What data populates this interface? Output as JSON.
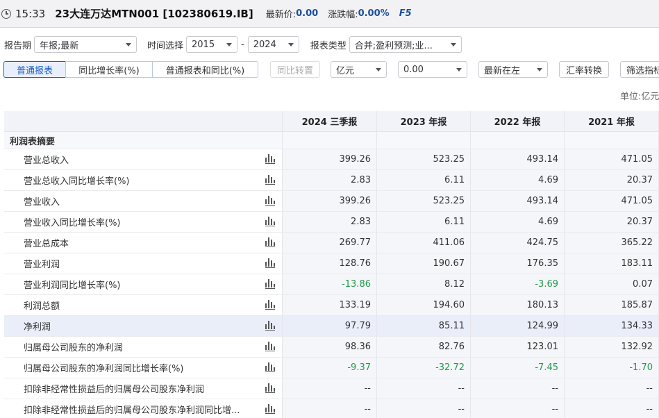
{
  "header": {
    "time": "15:33",
    "title": "23大连万达MTN001 [102380619.IB]",
    "latest_price_label": "最新价:",
    "latest_price": "0.00",
    "change_label": "涨跌幅:",
    "change": "0.00%",
    "shortcut": "F5"
  },
  "filters": {
    "report_period_label": "报告期",
    "report_period": "年报;最新",
    "time_label": "时间选择",
    "year_from": "2015",
    "dash": "-",
    "year_to": "2024",
    "report_type_label": "报表类型",
    "report_type": "合并;盈利预测;业..."
  },
  "toolbar": {
    "tab_normal": "普通报表",
    "tab_yoy": "同比增长率(%)",
    "tab_normal_yoy": "普通报表和同比(%)",
    "btn_transpose": "同比转置",
    "unit_select": "亿元",
    "decimal_select": "0.00",
    "order_select": "最新在左",
    "btn_fx": "汇率转换",
    "btn_filter": "筛选指标"
  },
  "unit_label": "单位:亿元",
  "table": {
    "columns": [
      "2024 三季报",
      "2023 年报",
      "2022 年报",
      "2021 年报"
    ],
    "section": "利润表摘要",
    "rows": [
      {
        "name": "营业总收入",
        "v": [
          "399.26",
          "523.25",
          "493.14",
          "471.05"
        ]
      },
      {
        "name": "营业总收入同比增长率(%)",
        "v": [
          "2.83",
          "6.11",
          "4.69",
          "20.37"
        ]
      },
      {
        "name": "营业收入",
        "v": [
          "399.26",
          "523.25",
          "493.14",
          "471.05"
        ]
      },
      {
        "name": "营业收入同比增长率(%)",
        "v": [
          "2.83",
          "6.11",
          "4.69",
          "20.37"
        ]
      },
      {
        "name": "营业总成本",
        "v": [
          "269.77",
          "411.06",
          "424.75",
          "365.22"
        ]
      },
      {
        "name": "营业利润",
        "v": [
          "128.76",
          "190.67",
          "176.35",
          "183.11"
        ]
      },
      {
        "name": "营业利润同比增长率(%)",
        "v": [
          "-13.86",
          "8.12",
          "-3.69",
          "0.07"
        ]
      },
      {
        "name": "利润总额",
        "v": [
          "133.19",
          "194.60",
          "180.13",
          "185.87"
        ]
      },
      {
        "name": "净利润",
        "v": [
          "97.79",
          "85.11",
          "124.99",
          "134.33"
        ]
      },
      {
        "name": "归属母公司股东的净利润",
        "v": [
          "98.36",
          "82.76",
          "123.01",
          "132.92"
        ]
      },
      {
        "name": "归属母公司股东的净利润同比增长率(%)",
        "v": [
          "-9.37",
          "-32.72",
          "-7.45",
          "-1.70"
        ]
      },
      {
        "name": "扣除非经常性损益后的归属母公司股东净利润",
        "v": [
          "--",
          "--",
          "--",
          "--"
        ]
      },
      {
        "name": "扣除非经常性损益后的归属母公司股东净利润同比增...",
        "v": [
          "--",
          "--",
          "--",
          "--"
        ]
      }
    ]
  },
  "colors": {
    "accent": "#1a5bc7",
    "negative": "#1f9a48",
    "highlight_row": "#e9eef9"
  },
  "icons": {
    "clock": "clock-icon",
    "chart": "bar-chart-icon",
    "dropdown": "chevron-down-icon"
  }
}
